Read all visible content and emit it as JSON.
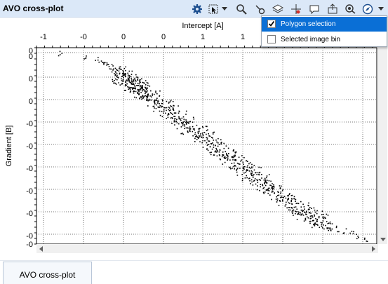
{
  "window": {
    "title": "AVO cross-plot"
  },
  "toolbar": {
    "icons": [
      "gear-icon",
      "selection-tool-icon",
      "magnifier-icon",
      "probe-icon",
      "layers-icon",
      "crosshair-icon",
      "comment-icon",
      "export-image-icon",
      "search-zoom-icon",
      "compass-icon"
    ]
  },
  "dropdown_menu": {
    "items": [
      {
        "label": "Polygon selection",
        "checked": true,
        "highlighted": true
      },
      {
        "label": "Selected image bin",
        "checked": false,
        "highlighted": false
      }
    ]
  },
  "chart_data": {
    "type": "scatter",
    "xlabel": "Intercept [A]",
    "ylabel": "Gradient [B]",
    "x_tick_labels": [
      "-1",
      "-0",
      "0",
      "0",
      "1",
      "1"
    ],
    "y_tick_labels": [
      "0",
      "0",
      "0",
      "0",
      "-0",
      "-0",
      "-0",
      "-0",
      "-0",
      "-0",
      "-0",
      "-0"
    ],
    "grid": true,
    "series": [
      {
        "color": "#000000",
        "x": [
          -1.55,
          -1.2,
          -1.02,
          -0.95,
          -0.9,
          -0.85,
          -0.78,
          -0.72,
          -0.68,
          -0.6,
          -0.55,
          -0.5,
          -0.45,
          -0.4,
          -0.35,
          -0.3,
          -0.2,
          -0.1,
          0.0,
          0.1,
          0.2,
          0.3,
          0.4,
          0.5,
          0.6,
          0.7,
          0.8,
          0.9,
          1.0,
          1.1,
          1.2,
          1.3,
          1.4,
          1.5,
          1.6,
          1.7,
          1.8,
          1.9,
          2.0,
          2.1,
          2.2,
          2.3,
          2.4,
          2.5,
          2.6,
          2.7,
          2.8,
          2.9
        ],
        "y": [
          0.9,
          0.85,
          0.82,
          0.8,
          0.78,
          0.75,
          0.7,
          0.67,
          0.65,
          0.6,
          0.57,
          0.55,
          0.52,
          0.5,
          0.47,
          0.44,
          0.38,
          0.32,
          0.27,
          0.21,
          0.15,
          0.09,
          0.03,
          -0.02,
          -0.08,
          -0.14,
          -0.2,
          -0.26,
          -0.31,
          -0.37,
          -0.43,
          -0.48,
          -0.54,
          -0.6,
          -0.66,
          -0.71,
          -0.76,
          -0.82,
          -0.88,
          -0.92,
          -0.96,
          -1.0,
          -1.04,
          -1.07,
          -1.1,
          -1.12,
          -1.15,
          -1.18
        ]
      }
    ]
  },
  "tabs": [
    {
      "label": "AVO cross-plot",
      "active": true
    }
  ]
}
